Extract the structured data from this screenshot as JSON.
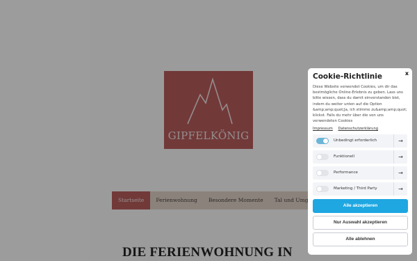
{
  "site": {
    "logo_text": "GIPFELKÖNIG",
    "brand_color": "#b95d5d",
    "nav": [
      {
        "label": "Startseite",
        "active": true
      },
      {
        "label": "Ferienwohnung"
      },
      {
        "label": "Besondere Momente"
      },
      {
        "label": "Tal und Umgebung"
      }
    ],
    "headline": "DIE FERIENWOHNUNG IN"
  },
  "cookie": {
    "title": "Cookie-Richtlinie",
    "close": "x",
    "body": "Diese Website verwendet Cookies, um dir das bestmögliche Online-Erlebnis zu geben. Lass uns bitte wissen, dass du damit einverstanden bist, indem du weiter unten auf die Option &amp;amp;quot;Ja, ich stimme zu&amp;amp;quot; klickst. Falls du mehr über die von uns verwendeten Cookies",
    "links": {
      "impressum": "Impressum",
      "privacy": "Datenschutzerklärung"
    },
    "categories": [
      {
        "label": "Unbedingt erforderlich",
        "enabled": true
      },
      {
        "label": "Funktionell",
        "enabled": false
      },
      {
        "label": "Performance",
        "enabled": false
      },
      {
        "label": "Marketing / Third Party",
        "enabled": false
      }
    ],
    "arrow_icon": "→",
    "accent_color": "#1ea7e1",
    "buttons": {
      "accept_all": "Alle akzeptieren",
      "accept_selection": "Nur Auswahl akzeptieren",
      "reject_all": "Alle ablehnen"
    }
  }
}
